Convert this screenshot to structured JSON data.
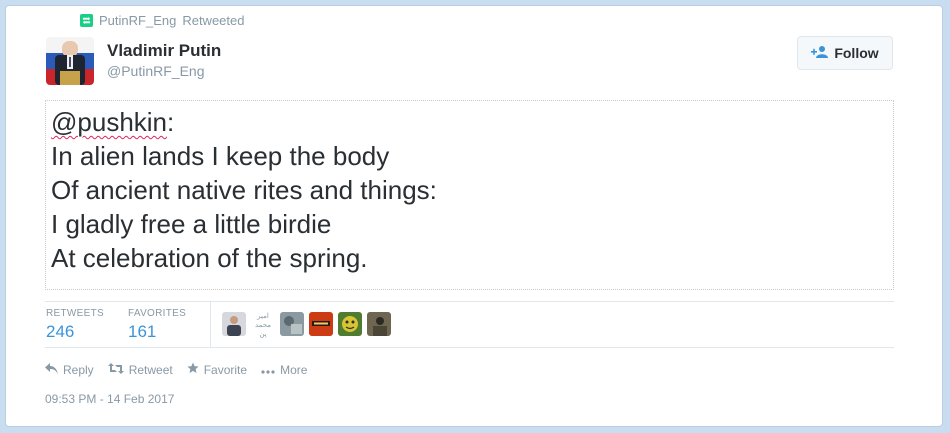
{
  "context": {
    "account": "PutinRF_Eng",
    "action": "Retweeted"
  },
  "author": {
    "name": "Vladimir Putin",
    "handle": "@PutinRF_Eng"
  },
  "follow": {
    "label": "Follow"
  },
  "tweet": {
    "mention": "@pushkin",
    "mention_suffix": ":",
    "lines": [
      "In alien lands I keep the body",
      "Of ancient native rites and things:",
      "I gladly free a little birdie",
      "At celebration of the spring."
    ]
  },
  "stats": {
    "retweets_label": "RETWEETS",
    "retweets_value": "246",
    "favorites_label": "FAVORITES",
    "favorites_value": "161"
  },
  "faces": {
    "caption": "امیر محمد پن",
    "colors": [
      "#6b6f7c",
      "#8a9aa0",
      "#cc3b14",
      "#d8c531",
      "#6e6651"
    ]
  },
  "actions": {
    "reply": "Reply",
    "retweet": "Retweet",
    "favorite": "Favorite",
    "more": "More"
  },
  "timestamp": "09:53 PM - 14 Feb 2017",
  "colors": {
    "link_blue": "#3b94d9",
    "muted": "#8899a6",
    "text": "#292f33",
    "retweet_green": "#19cf86"
  }
}
